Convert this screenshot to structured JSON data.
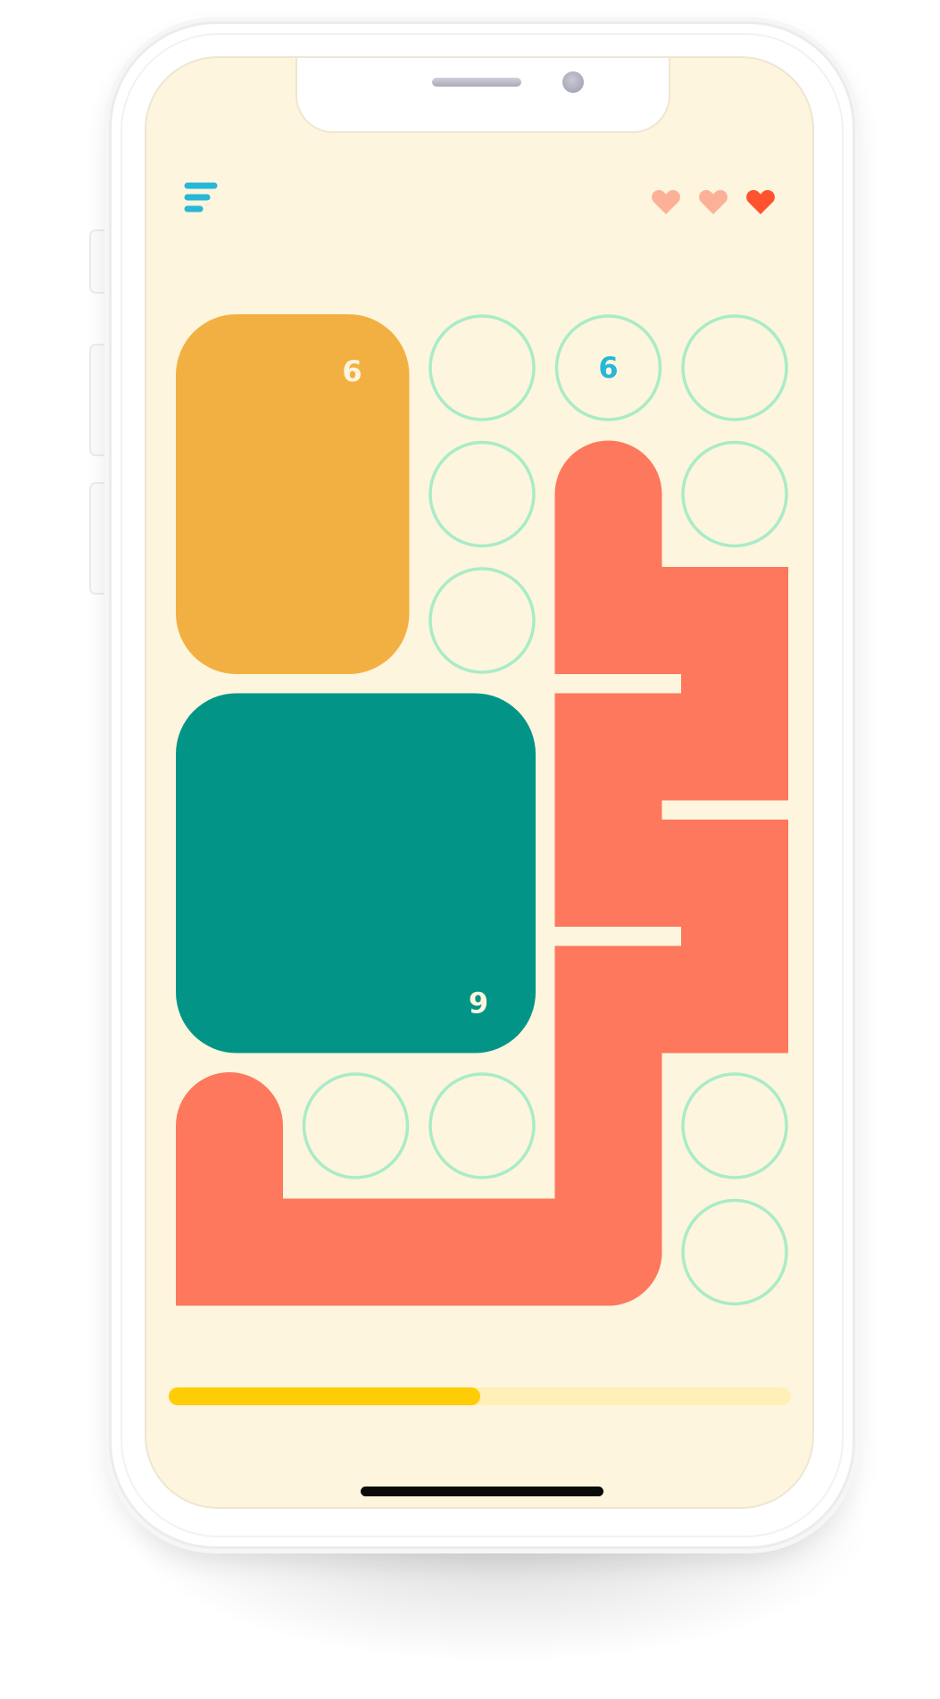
{
  "colors": {
    "background": "#fdf5dd",
    "menu": "#27b7d8",
    "empty_cell_ring": "#a8ecc7",
    "block_orange": "#f3b042",
    "block_teal": "#029587",
    "path_salmon": "#fd785c",
    "heart_full": "#ff532f",
    "heart_spent": "#fdb098",
    "progress_track": "#fff0b7",
    "progress_fill": "#ffcd05",
    "number_light": "#fdf5dd",
    "number_blue": "#27b7d8"
  },
  "toolbar": {
    "menu_icon": "menu-lines-icon"
  },
  "lives": {
    "icon": "heart-icon",
    "total": 3,
    "hearts": [
      "spent",
      "spent",
      "full"
    ]
  },
  "board": {
    "rows": 8,
    "cols": 5,
    "blocks": [
      {
        "id": "orange",
        "color": "#f3b042",
        "cells": [
          [
            0,
            0
          ],
          [
            0,
            1
          ],
          [
            1,
            0
          ],
          [
            1,
            1
          ],
          [
            2,
            0
          ],
          [
            2,
            1
          ]
        ],
        "clue": {
          "text": "6",
          "cell": [
            0,
            1
          ]
        }
      },
      {
        "id": "teal",
        "color": "#029587",
        "cells": [
          [
            3,
            0
          ],
          [
            3,
            1
          ],
          [
            3,
            2
          ],
          [
            4,
            0
          ],
          [
            4,
            1
          ],
          [
            4,
            2
          ],
          [
            5,
            0
          ],
          [
            5,
            1
          ],
          [
            5,
            2
          ]
        ],
        "clue": {
          "text": "9",
          "cell": [
            5,
            2
          ]
        }
      }
    ],
    "paths": [
      {
        "id": "right-snake",
        "color": "#fd785c",
        "cells": [
          [
            1,
            3
          ],
          [
            2,
            3
          ],
          [
            2,
            4
          ],
          [
            3,
            4
          ],
          [
            3,
            3
          ],
          [
            4,
            3
          ],
          [
            4,
            4
          ],
          [
            5,
            4
          ],
          [
            5,
            3
          ],
          [
            6,
            3
          ],
          [
            7,
            3
          ]
        ]
      },
      {
        "id": "bottom-hook",
        "color": "#fd785c",
        "cells": [
          [
            6,
            0
          ],
          [
            7,
            0
          ],
          [
            7,
            1
          ],
          [
            7,
            2
          ],
          [
            7,
            3
          ]
        ]
      }
    ],
    "empty_cells": [
      [
        0,
        2
      ],
      [
        0,
        3
      ],
      [
        0,
        4
      ],
      [
        1,
        2
      ],
      [
        1,
        4
      ],
      [
        2,
        2
      ],
      [
        6,
        1
      ],
      [
        6,
        2
      ],
      [
        6,
        4
      ],
      [
        7,
        4
      ]
    ],
    "clues": [
      {
        "cell": [
          0,
          3
        ],
        "text": "6",
        "color": "#27b7d8"
      }
    ]
  },
  "progress": {
    "fraction": 0.5
  }
}
